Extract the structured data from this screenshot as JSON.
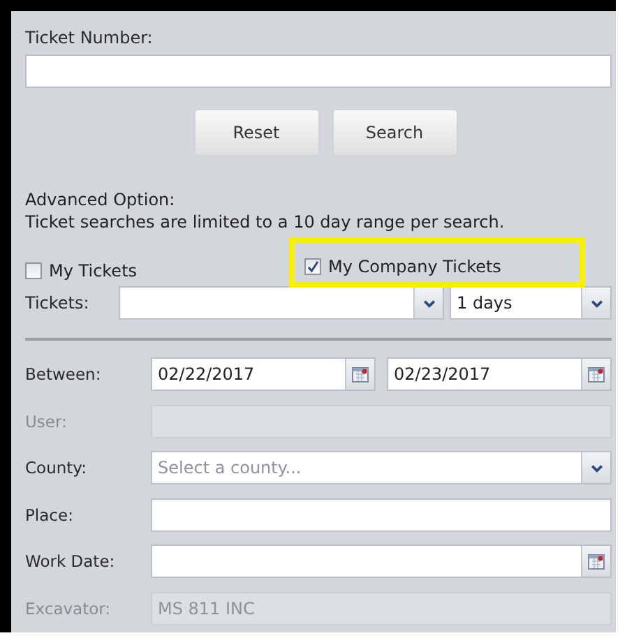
{
  "ticket_number": {
    "label": "Ticket Number:"
  },
  "buttons": [
    "Reset",
    "Search"
  ],
  "advanced": {
    "title": "Advanced Option:",
    "note": "Ticket searches are limited to a 10 day range per search."
  },
  "checkboxes": [
    {
      "label": "My Tickets",
      "checked": false,
      "highlighted": false
    },
    {
      "label": "My Company Tickets",
      "checked": true,
      "highlighted": true
    }
  ],
  "tickets": {
    "label": "Tickets:",
    "range": "1 days"
  },
  "fields": [
    {
      "kind": "date-range",
      "label": "Between:",
      "disabled": false,
      "values": [
        "02/22/2017",
        "02/23/2017"
      ]
    },
    {
      "kind": "text",
      "label": "User:",
      "disabled": true
    },
    {
      "kind": "select",
      "label": "County:",
      "disabled": false,
      "placeholder": "Select a county..."
    },
    {
      "kind": "text",
      "label": "Place:",
      "disabled": false
    },
    {
      "kind": "date",
      "label": "Work Date:",
      "disabled": false
    },
    {
      "kind": "text",
      "label": "Excavator:",
      "disabled": true,
      "value": "MS 811 INC"
    }
  ]
}
